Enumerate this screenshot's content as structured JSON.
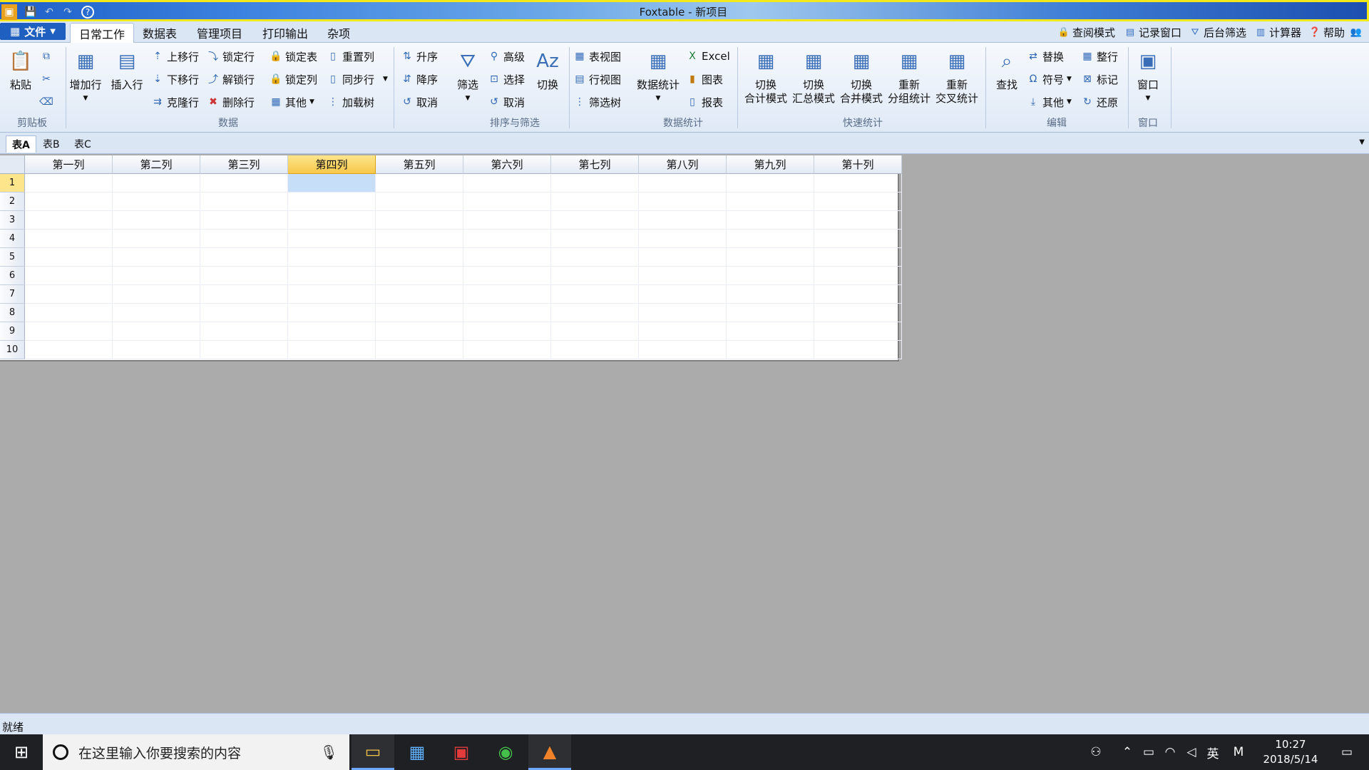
{
  "window": {
    "title": "Foxtable - 新项目"
  },
  "menu": {
    "file_label": "文件",
    "tabs": [
      {
        "label": "日常工作",
        "active": true
      },
      {
        "label": "数据表",
        "active": false
      },
      {
        "label": "管理项目",
        "active": false
      },
      {
        "label": "打印输出",
        "active": false
      },
      {
        "label": "杂项",
        "active": false
      }
    ],
    "quick_buttons": [
      "查阅模式",
      "记录窗口",
      "后台筛选",
      "计算器",
      "帮助"
    ]
  },
  "ribbon": {
    "clipboard": {
      "paste": "粘贴",
      "group": "剪贴板"
    },
    "data": {
      "add_row": "增加行",
      "insert_row": "插入行",
      "move_up": "上移行",
      "move_down": "下移行",
      "clone_row": "克隆行",
      "lock_row": "锁定行",
      "unlock_row": "解锁行",
      "delete_row": "删除行",
      "lock_table": "锁定表",
      "lock_col": "锁定列",
      "other": "其他",
      "reset_col": "重置列",
      "sync_row": "同步行",
      "load_tree": "加载树",
      "group": "数据"
    },
    "sort": {
      "asc": "升序",
      "desc": "降序",
      "cancel": "取消",
      "filter": "筛选",
      "advanced": "高级",
      "select": "选择",
      "cancel2": "取消",
      "toggle": "切换",
      "group": "排序与筛选"
    },
    "stats": {
      "table_view": "表视图",
      "row_view": "行视图",
      "filter_tree": "筛选树",
      "data_stats": "数据统计",
      "excel": "Excel",
      "chart": "图表",
      "report": "报表",
      "group": "数据统计"
    },
    "quick": {
      "b1": [
        "切换",
        "合计模式"
      ],
      "b2": [
        "切换",
        "汇总模式"
      ],
      "b3": [
        "切换",
        "合并模式"
      ],
      "b4": [
        "重新",
        "分组统计"
      ],
      "b5": [
        "重新",
        "交叉统计"
      ],
      "group": "快速统计"
    },
    "edit": {
      "find": "查找",
      "replace": "替换",
      "symbol": "符号",
      "other": "其他",
      "whole_row": "整行",
      "mark": "标记",
      "restore": "还原",
      "group": "编辑"
    },
    "window": {
      "label": "窗口",
      "group": "窗口"
    }
  },
  "sheets": [
    {
      "label": "表A",
      "active": true
    },
    {
      "label": "表B",
      "active": false
    },
    {
      "label": "表C",
      "active": false
    }
  ],
  "grid": {
    "columns": [
      "第一列",
      "第二列",
      "第三列",
      "第四列",
      "第五列",
      "第六列",
      "第七列",
      "第八列",
      "第九列",
      "第十列"
    ],
    "rows": [
      "1",
      "2",
      "3",
      "4",
      "5",
      "6",
      "7",
      "8",
      "9",
      "10"
    ],
    "selected_col": 3,
    "selected_row": 0
  },
  "status": {
    "text": "就绪"
  },
  "taskbar": {
    "search_placeholder": "在这里输入你要搜索的内容",
    "ime": "英",
    "ime2": "M",
    "time": "10:27",
    "date": "2018/5/14"
  }
}
